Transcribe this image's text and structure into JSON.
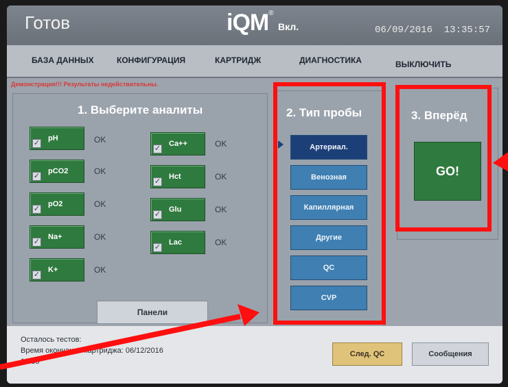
{
  "header": {
    "status": "Готов",
    "logo_text": "iQM",
    "logo_reg": "®",
    "logo_state": "Вкл.",
    "date": "06/09/2016",
    "time": "13:35:57"
  },
  "menu": [
    "БАЗА ДАННЫХ",
    "КОНФИГУРАЦИЯ",
    "КАРТРИДЖ",
    "ДИАГНОСТИКА",
    "ВЫКЛЮЧИТЬ"
  ],
  "demo_warning": "Демонстрация!!! Результаты недействительны.",
  "analytes_panel": {
    "title": "1. Выберите аналиты",
    "items": [
      {
        "label": "pH",
        "status": "OK"
      },
      {
        "label": "pCO2",
        "status": "OK"
      },
      {
        "label": "pO2",
        "status": "OK"
      },
      {
        "label": "Na+",
        "status": "OK"
      },
      {
        "label": "K+",
        "status": "OK"
      },
      {
        "label": "Ca++",
        "status": "OK"
      },
      {
        "label": "Hct",
        "status": "OK"
      },
      {
        "label": "Glu",
        "status": "OK"
      },
      {
        "label": "Lac",
        "status": "OK"
      }
    ],
    "panels_button": "Панели"
  },
  "sample_panel": {
    "title": "2. Тип пробы",
    "options": [
      "Артериал.",
      "Венозная",
      "Капиллярная",
      "Другие",
      "QC",
      "CVP"
    ],
    "selected": "Артериал."
  },
  "go_panel": {
    "title": "3. Вперёд",
    "button": "GO!"
  },
  "footer": {
    "tests_left": "Осталось тестов:",
    "cartridge_expiry": "Время окончания картриджа: 06/12/2016",
    "time_fragment": "13:35",
    "next_qc_button": "След. QC",
    "messages_button": "Сообщения"
  },
  "colors": {
    "annotation": "#ff0f0f",
    "analyte_button": "#2f7a3e",
    "sample_button": "#3f7fb2",
    "sample_selected": "#1d3f78"
  }
}
